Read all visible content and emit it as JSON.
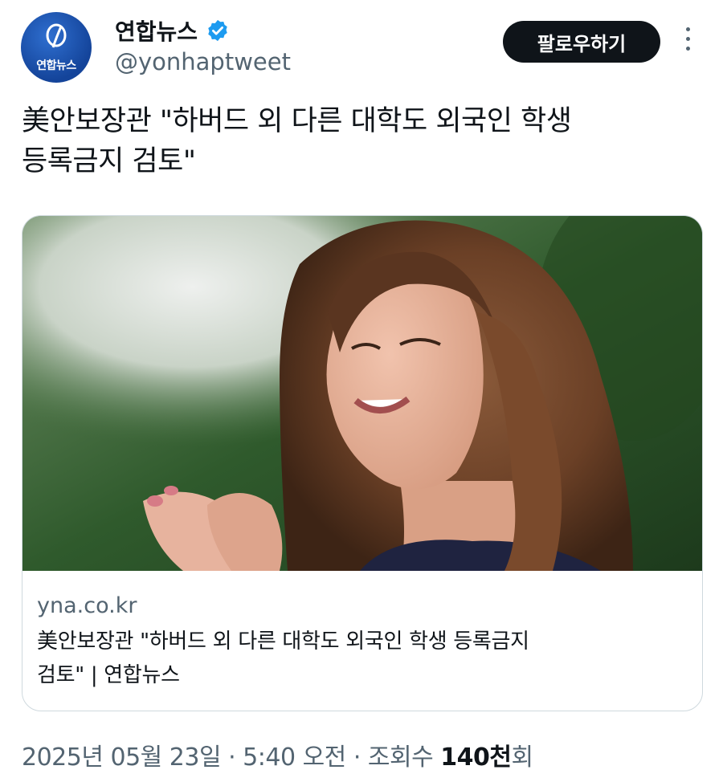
{
  "account": {
    "display_name": "연합뉴스",
    "handle": "@yonhaptweet",
    "avatar_text": "연합뉴스",
    "verified_icon": "verified-badge-icon",
    "verified_color": "#1d9bf0"
  },
  "actions": {
    "follow_label": "팔로우하기",
    "more_icon": "more-vertical-icon"
  },
  "tweet": {
    "text_line1": "美안보장관 \"하버드 외 다른 대학도 외국인 학생",
    "text_line2": "등록금지 검토\""
  },
  "card": {
    "image_subject": "smiling woman with long brown hair, hands clasped, green blurred background",
    "domain": "yna.co.kr",
    "title_line1": "美안보장관 \"하버드 외 다른 대학도 외국인 학생 등록금지",
    "title_line2": "검토\" | 연합뉴스"
  },
  "meta": {
    "datetime": "2025년 05월 23일 · 5:40 오전",
    "separator": " · ",
    "views_label_prefix": "조회수 ",
    "views_count": "140천",
    "views_label_suffix": "회"
  },
  "colors": {
    "text_primary": "#0f1419",
    "text_secondary": "#536471",
    "border": "#cfd9de",
    "button_bg": "#0f1419",
    "brand_blue": "#1d4fa8"
  }
}
